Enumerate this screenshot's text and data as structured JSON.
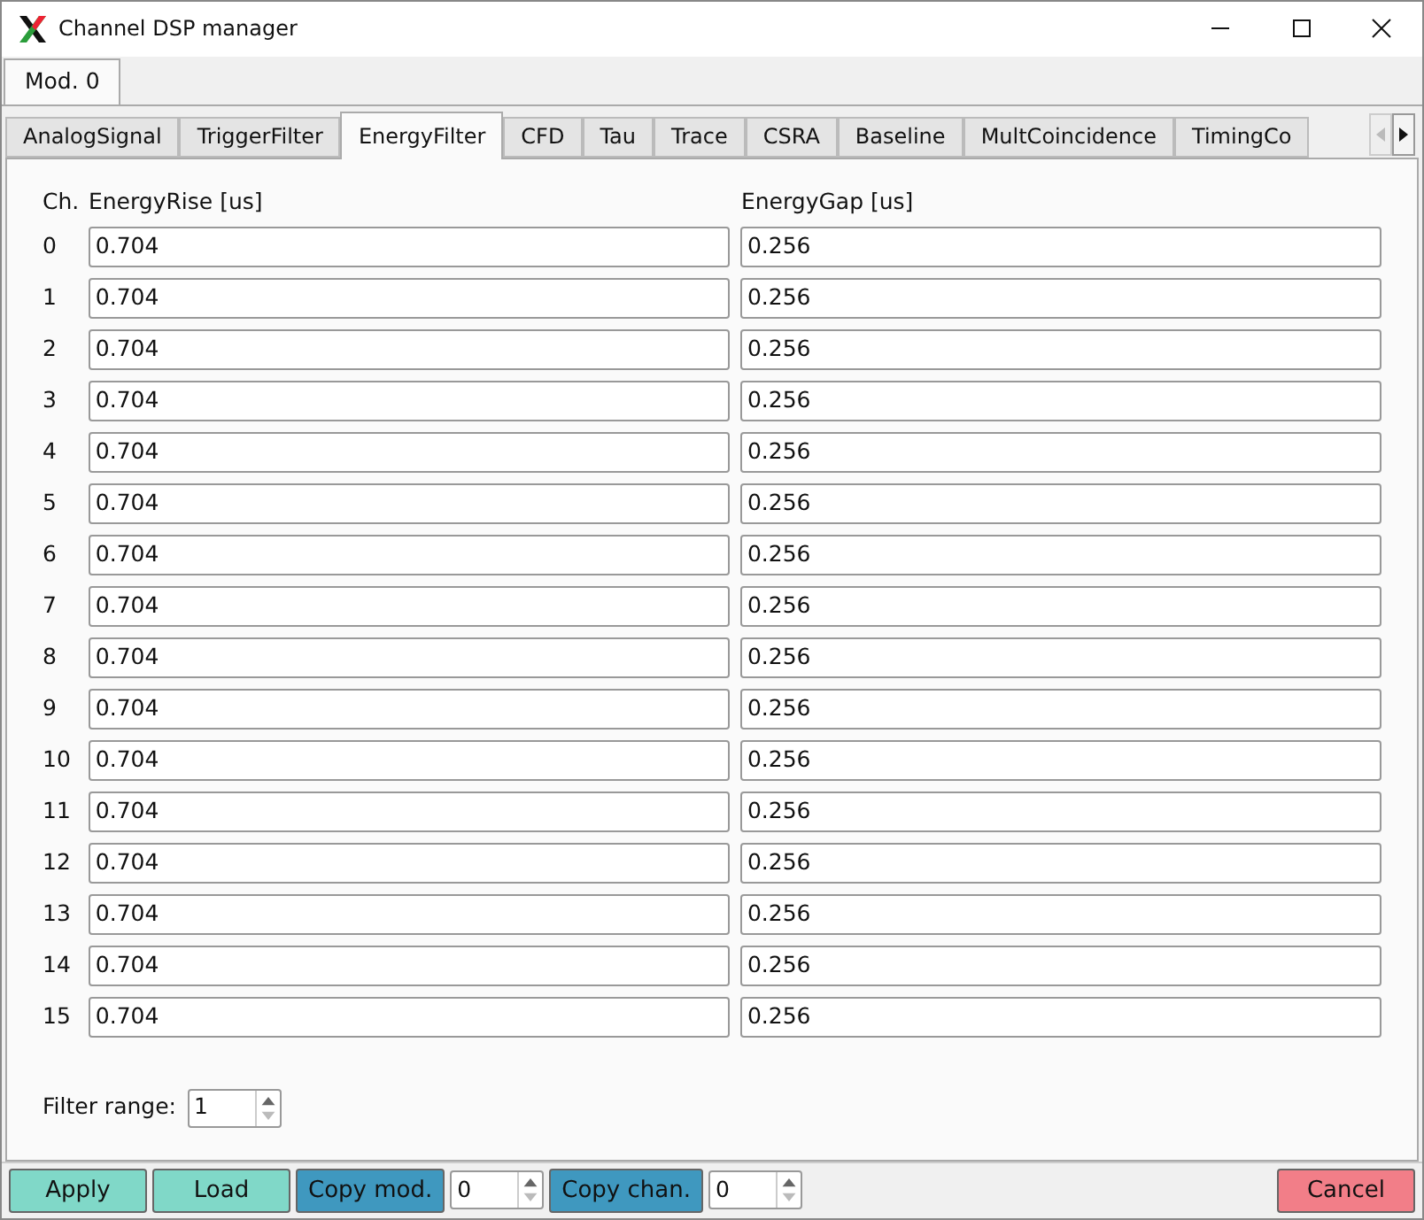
{
  "window": {
    "title": "Channel DSP manager"
  },
  "module_tabs": [
    {
      "label": "Mod. 0",
      "selected": true
    }
  ],
  "tabs": [
    {
      "label": "AnalogSignal",
      "selected": false
    },
    {
      "label": "TriggerFilter",
      "selected": false
    },
    {
      "label": "EnergyFilter",
      "selected": true
    },
    {
      "label": "CFD",
      "selected": false
    },
    {
      "label": "Tau",
      "selected": false
    },
    {
      "label": "Trace",
      "selected": false
    },
    {
      "label": "CSRA",
      "selected": false
    },
    {
      "label": "Baseline",
      "selected": false
    },
    {
      "label": "MultCoincidence",
      "selected": false
    },
    {
      "label": "TimingCo",
      "selected": false
    }
  ],
  "table": {
    "columns": [
      "Ch.",
      "EnergyRise [us]",
      "EnergyGap [us]"
    ],
    "rows": [
      {
        "ch": "0",
        "rise": "0.704",
        "gap": "0.256"
      },
      {
        "ch": "1",
        "rise": "0.704",
        "gap": "0.256"
      },
      {
        "ch": "2",
        "rise": "0.704",
        "gap": "0.256"
      },
      {
        "ch": "3",
        "rise": "0.704",
        "gap": "0.256"
      },
      {
        "ch": "4",
        "rise": "0.704",
        "gap": "0.256"
      },
      {
        "ch": "5",
        "rise": "0.704",
        "gap": "0.256"
      },
      {
        "ch": "6",
        "rise": "0.704",
        "gap": "0.256"
      },
      {
        "ch": "7",
        "rise": "0.704",
        "gap": "0.256"
      },
      {
        "ch": "8",
        "rise": "0.704",
        "gap": "0.256"
      },
      {
        "ch": "9",
        "rise": "0.704",
        "gap": "0.256"
      },
      {
        "ch": "10",
        "rise": "0.704",
        "gap": "0.256"
      },
      {
        "ch": "11",
        "rise": "0.704",
        "gap": "0.256"
      },
      {
        "ch": "12",
        "rise": "0.704",
        "gap": "0.256"
      },
      {
        "ch": "13",
        "rise": "0.704",
        "gap": "0.256"
      },
      {
        "ch": "14",
        "rise": "0.704",
        "gap": "0.256"
      },
      {
        "ch": "15",
        "rise": "0.704",
        "gap": "0.256"
      }
    ]
  },
  "filter_range": {
    "label": "Filter range:",
    "value": "1"
  },
  "bottom_bar": [
    {
      "kind": "button",
      "label": "Apply",
      "color": "#80d8c8"
    },
    {
      "kind": "button",
      "label": "Load",
      "color": "#80d8c8"
    },
    {
      "kind": "button",
      "label": "Copy mod.",
      "color": "#3f98bf"
    },
    {
      "kind": "spin",
      "value": "0"
    },
    {
      "kind": "button",
      "label": "Copy chan.",
      "color": "#3f98bf"
    },
    {
      "kind": "spin",
      "value": "0"
    },
    {
      "kind": "spacer"
    },
    {
      "kind": "button",
      "label": "Cancel",
      "color": "#f27e88"
    }
  ]
}
